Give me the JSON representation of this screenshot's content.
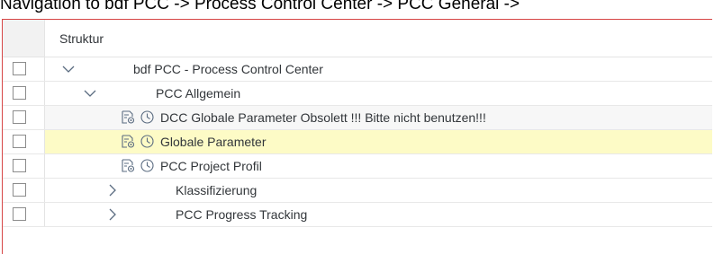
{
  "caption": "Navigation to bdf PCC -> Process Control Center -> PCC General ->",
  "table": {
    "column_header": "Struktur",
    "rows": [
      {
        "label": "bdf PCC - Process Control Center",
        "toggle": "chevron-down"
      },
      {
        "label": "PCC Allgemein",
        "toggle": "chevron-down"
      },
      {
        "label": "DCC Globale Parameter  Obsolett !!! Bitte nicht benutzen!!!",
        "icons": [
          "parameter-icon",
          "clock-icon"
        ]
      },
      {
        "label": "Globale Parameter",
        "icons": [
          "parameter-icon",
          "clock-icon"
        ],
        "highlighted": true
      },
      {
        "label": "PCC Project Profil",
        "icons": [
          "parameter-icon",
          "clock-icon"
        ]
      },
      {
        "label": "Klassifizierung",
        "toggle": "chevron-right"
      },
      {
        "label": "PCC Progress Tracking",
        "toggle": "chevron-right"
      }
    ]
  },
  "colors": {
    "frame_border": "#d64545",
    "highlight": "#fdfbc6",
    "icon": "#5a6b80"
  }
}
